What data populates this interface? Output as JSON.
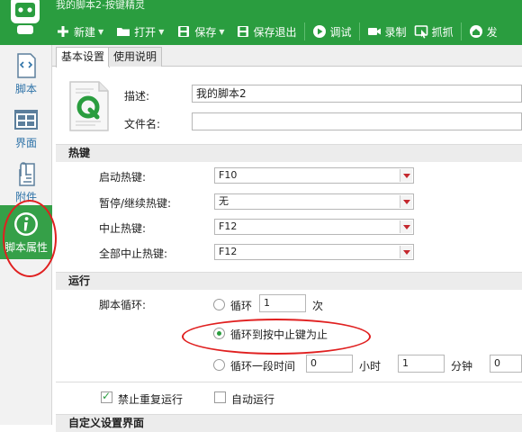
{
  "window": {
    "title": "我的脚本2-按键精灵"
  },
  "toolbar": {
    "new_label": "新建",
    "open_label": "打开",
    "save_label": "保存",
    "save_exit_label": "保存退出",
    "debug_label": "调试",
    "record_label": "录制",
    "capture_label": "抓抓",
    "publish_label": "发"
  },
  "sidebar": {
    "items": [
      {
        "label": "脚本",
        "icon": "script-code-icon"
      },
      {
        "label": "界面",
        "icon": "interface-grid-icon"
      },
      {
        "label": "附件",
        "icon": "attachment-icon"
      },
      {
        "label": "脚本属性",
        "icon": "info-icon"
      }
    ],
    "active": "脚本属性"
  },
  "tabs": [
    {
      "label": "基本设置",
      "active": true
    },
    {
      "label": "使用说明",
      "active": false
    }
  ],
  "basic": {
    "desc_label": "描述:",
    "desc_value": "我的脚本2",
    "filename_label": "文件名:",
    "filename_value": ""
  },
  "hotkeys": {
    "section_title": "热键",
    "rows": [
      {
        "label": "启动热键:",
        "value": "F10"
      },
      {
        "label": "暂停/继续热键:",
        "value": "无"
      },
      {
        "label": "中止热键:",
        "value": "F12"
      },
      {
        "label": "全部中止热键:",
        "value": "F12"
      }
    ]
  },
  "run": {
    "section_title": "运行",
    "loop_label": "脚本循环:",
    "opt_loop_label": "循环",
    "loop_count": "1",
    "times_unit": "次",
    "opt_until_label": "循环到按中止键为止",
    "opt_period_label": "循环一段时间",
    "hours_value": "0",
    "hours_unit": "小时",
    "minutes_value": "1",
    "minutes_unit": "分钟",
    "seconds_value": "0",
    "selected": "until"
  },
  "options": {
    "no_repeat_label": "禁止重复运行",
    "no_repeat_checked": true,
    "auto_run_label": "自动运行",
    "auto_run_checked": false
  },
  "custom_section_title": "自定义设置界面",
  "colors": {
    "brand_green": "#2a9d3f",
    "annotation_red": "#e02020",
    "link_blue": "#2f73a8"
  }
}
